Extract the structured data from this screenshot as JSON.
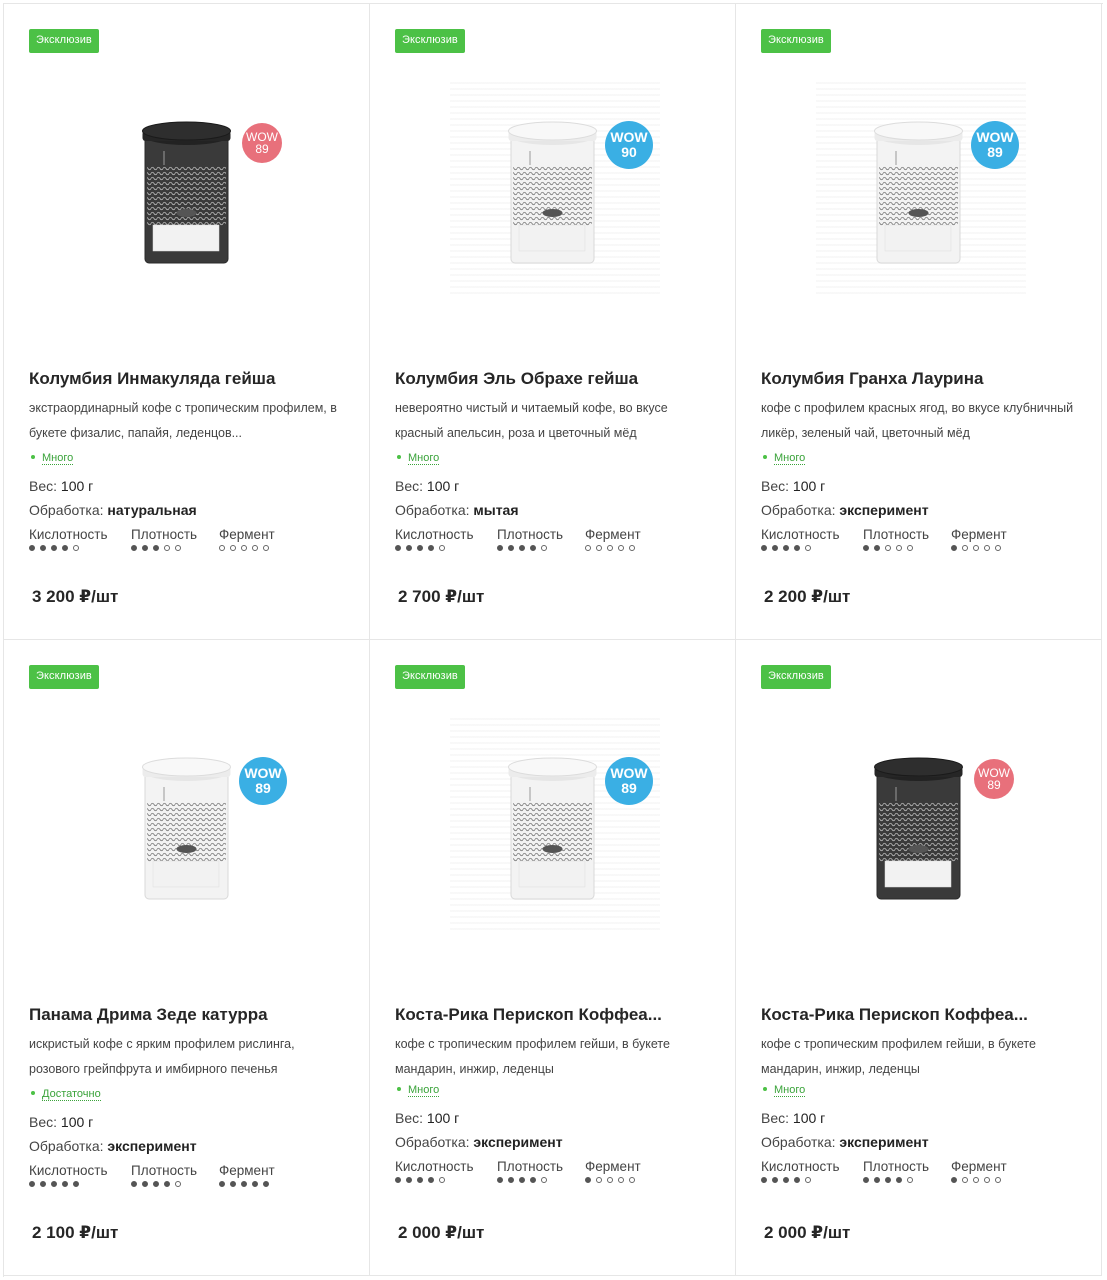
{
  "products": [
    {
      "badge": "Эксклюзив",
      "wow_top": "WOW",
      "wow_score": "89",
      "wow_color": "#e8707b",
      "wow_small": true,
      "can_color": "dark",
      "faded": false,
      "title": "Колумбия Инмакуляда гейша",
      "description": "экстраординарный кофе с тропическим профилем, в букете физалис, папайя, леденцов...",
      "stock": "Много",
      "weight_label": "Вес:",
      "weight_value": "100 г",
      "processing_label": "Обработка:",
      "processing_value": "натуральная",
      "acidity_label": "Кислотность",
      "acidity": 4,
      "density_label": "Плотность",
      "density": 3,
      "ferment_label": "Фермент",
      "ferment": 0,
      "price": "3 200 ₽/шт"
    },
    {
      "badge": "Эксклюзив",
      "wow_top": "WOW",
      "wow_score": "90",
      "wow_color": "#3aafe4",
      "wow_small": false,
      "can_color": "light",
      "faded": true,
      "title": "Колумбия Эль Обрахе гейша",
      "description": "невероятно чистый и читаемый кофе, во вкусе красный апельсин, роза и цветочный мёд",
      "stock": "Много",
      "weight_label": "Вес:",
      "weight_value": "100 г",
      "processing_label": "Обработка:",
      "processing_value": "мытая",
      "acidity_label": "Кислотность",
      "acidity": 4,
      "density_label": "Плотность",
      "density": 4,
      "ferment_label": "Фермент",
      "ferment": 0,
      "price": "2 700 ₽/шт"
    },
    {
      "badge": "Эксклюзив",
      "wow_top": "WOW",
      "wow_score": "89",
      "wow_color": "#3aafe4",
      "wow_small": false,
      "can_color": "light",
      "faded": true,
      "title": "Колумбия Гранха Лаурина",
      "description": "кофе с профилем красных ягод, во вкусе клубничный ликёр, зеленый чай, цветочный мёд",
      "stock": "Много",
      "weight_label": "Вес:",
      "weight_value": "100 г",
      "processing_label": "Обработка:",
      "processing_value": "эксперимент",
      "acidity_label": "Кислотность",
      "acidity": 4,
      "density_label": "Плотность",
      "density": 2,
      "ferment_label": "Фермент",
      "ferment": 1,
      "price": "2 200 ₽/шт"
    },
    {
      "badge": "Эксклюзив",
      "wow_top": "WOW",
      "wow_score": "89",
      "wow_color": "#3aafe4",
      "wow_small": false,
      "can_color": "light",
      "faded": false,
      "title": "Панама Дрима Зеде катурра",
      "description": "искристый кофе с ярким профилем рислинга, розового грейпфрута и имбирного печенья",
      "stock": "Достаточно",
      "weight_label": "Вес:",
      "weight_value": "100 г",
      "processing_label": "Обработка:",
      "processing_value": "эксперимент",
      "acidity_label": "Кислотность",
      "acidity": 5,
      "density_label": "Плотность",
      "density": 4,
      "ferment_label": "Фермент",
      "ferment": 5,
      "price": "2 100 ₽/шт"
    },
    {
      "badge": "Эксклюзив",
      "wow_top": "WOW",
      "wow_score": "89",
      "wow_color": "#3aafe4",
      "wow_small": false,
      "can_color": "light",
      "faded": true,
      "title": "Коста-Рика Перископ Коффеа...",
      "description": "кофе с тропическим профилем гейши, в букете мандарин, инжир, леденцы",
      "stock": "Много",
      "weight_label": "Вес:",
      "weight_value": "100 г",
      "processing_label": "Обработка:",
      "processing_value": "эксперимент",
      "acidity_label": "Кислотность",
      "acidity": 4,
      "density_label": "Плотность",
      "density": 4,
      "ferment_label": "Фермент",
      "ferment": 1,
      "price": "2 000 ₽/шт"
    },
    {
      "badge": "Эксклюзив",
      "wow_top": "WOW",
      "wow_score": "89",
      "wow_color": "#e8707b",
      "wow_small": true,
      "can_color": "dark",
      "faded": false,
      "title": "Коста-Рика Перископ Коффеа...",
      "description": "кофе с тропическим профилем гейши, в букете мандарин, инжир, леденцы",
      "stock": "Много",
      "weight_label": "Вес:",
      "weight_value": "100 г",
      "processing_label": "Обработка:",
      "processing_value": "эксперимент",
      "acidity_label": "Кислотность",
      "acidity": 4,
      "density_label": "Плотность",
      "density": 4,
      "ferment_label": "Фермент",
      "ferment": 1,
      "price": "2 000 ₽/шт"
    }
  ]
}
